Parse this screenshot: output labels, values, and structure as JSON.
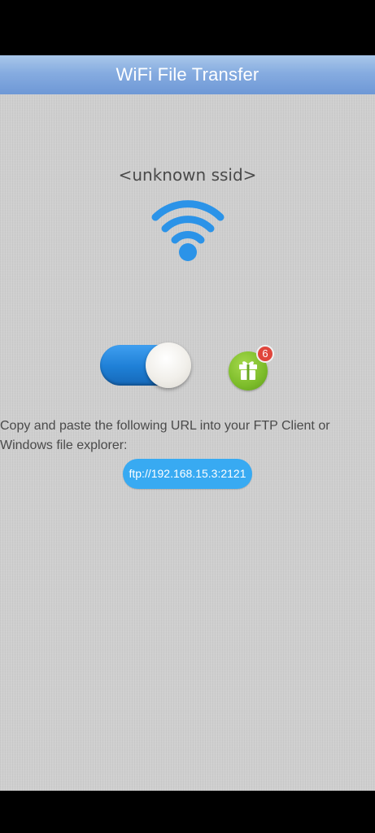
{
  "app_bar": {
    "title": "WiFi File Transfer"
  },
  "network": {
    "ssid": "<unknown ssid>",
    "icon": "wifi-icon"
  },
  "controls": {
    "server_toggle": {
      "state": "on",
      "icon": "toggle-switch"
    },
    "gift": {
      "icon": "gift-icon",
      "badge_count": "6"
    }
  },
  "instructions": {
    "text": "Copy and paste the following URL into your FTP Client or Windows file explorer:"
  },
  "url": {
    "value": "ftp://192.168.15.3:2121"
  },
  "colors": {
    "app_bar": "#86ace0",
    "wifi": "#2b93e8",
    "toggle_on": "#1e7fd6",
    "url_pill": "#38aaf2",
    "gift": "#7cbc2a",
    "badge": "#e0463c"
  }
}
